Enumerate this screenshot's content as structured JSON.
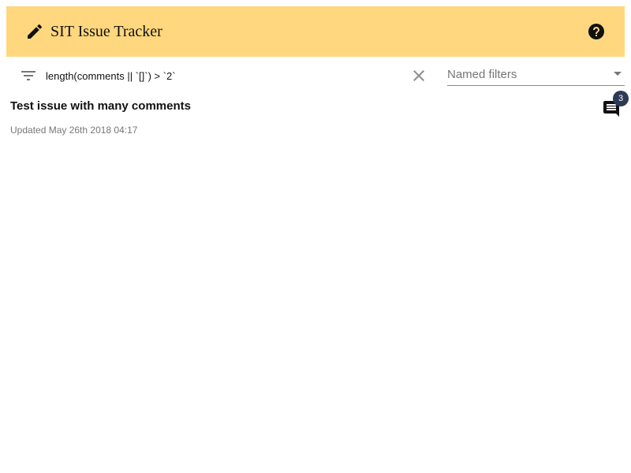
{
  "app": {
    "title": "SIT Issue Tracker"
  },
  "filter": {
    "query": "length(comments || `[]`) > `2`",
    "named_filters_label": "Named filters"
  },
  "issues": [
    {
      "title": "Test issue with many comments",
      "updated": "Updated May 26th 2018 04:17",
      "comment_count": "3"
    }
  ],
  "colors": {
    "toolbar": "#ffd77f",
    "badge": "#2d3a55"
  },
  "icons": [
    "edit-icon",
    "help-icon",
    "filter-icon",
    "clear-icon",
    "dropdown-arrow-icon",
    "comments-icon"
  ]
}
